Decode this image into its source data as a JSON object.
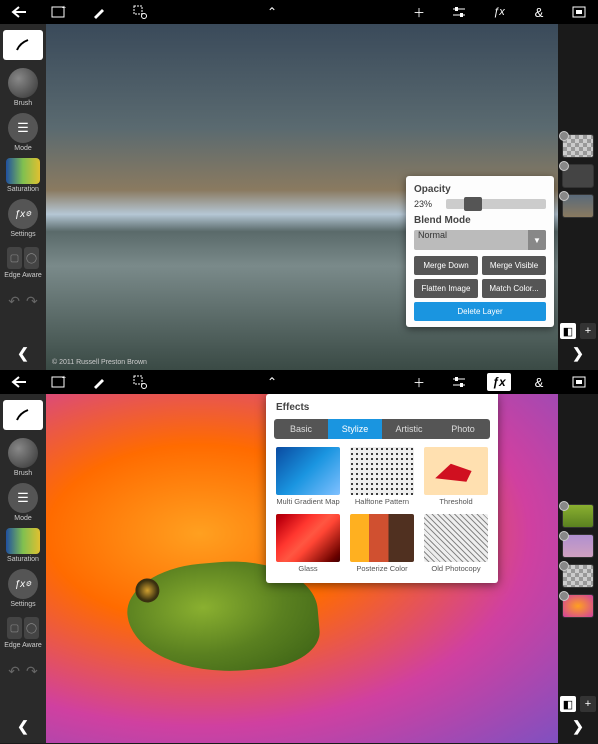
{
  "top": {
    "topbar_icons": {
      "back": "back",
      "image": "image",
      "pencil": "pencil",
      "crop": "crop",
      "caret": "expand",
      "plus": "add",
      "sliders": "adjust",
      "fx": "fx",
      "and": "blend",
      "full": "fullscreen"
    },
    "sidebar": {
      "brush_label": "Brush",
      "mode_label": "Mode",
      "saturation_label": "Saturation",
      "settings_label": "Settings",
      "edgeaware_label": "Edge Aware"
    },
    "panel": {
      "opacity_label": "Opacity",
      "opacity_value": "23%",
      "blend_label": "Blend Mode",
      "blend_value": "Normal",
      "merge_down": "Merge Down",
      "merge_visible": "Merge Visible",
      "flatten": "Flatten Image",
      "match_color": "Match Color...",
      "delete_layer": "Delete Layer"
    },
    "credit": "© 2011 Russell Preston Brown"
  },
  "bottom": {
    "sidebar": {
      "brush_label": "Brush",
      "mode_label": "Mode",
      "saturation_label": "Saturation",
      "settings_label": "Settings",
      "edgeaware_label": "Edge Aware"
    },
    "fx": {
      "title": "Effects",
      "tabs": {
        "basic": "Basic",
        "stylize": "Stylize",
        "artistic": "Artistic",
        "photo": "Photo"
      },
      "items": {
        "mgm": "Multi Gradient Map",
        "halftone": "Halftone Pattern",
        "threshold": "Threshold",
        "glass": "Glass",
        "posterize": "Posterize Color",
        "photocopy": "Old Photocopy"
      }
    }
  }
}
